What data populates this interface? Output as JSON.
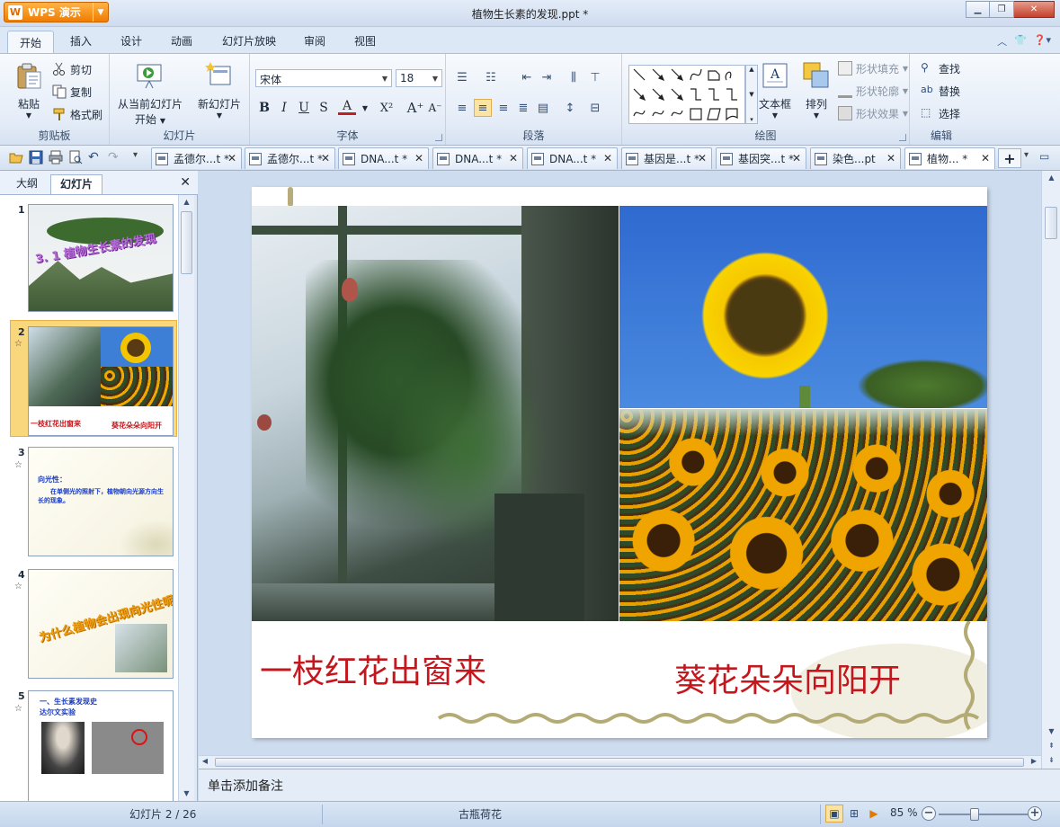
{
  "app": {
    "name": "WPS 演示",
    "logo_letter": "W",
    "document_title": "植物生长素的发现.ppt *"
  },
  "ribbon_tabs": [
    "开始",
    "插入",
    "设计",
    "动画",
    "幻灯片放映",
    "审阅",
    "视图"
  ],
  "ribbon": {
    "clipboard": {
      "paste": "粘贴",
      "cut": "剪切",
      "copy": "复制",
      "format_painter": "格式刷",
      "label": "剪贴板"
    },
    "slides": {
      "play_from_current": "从当前幻灯片",
      "play_from_current_2": "开始",
      "new_slide": "新幻灯片",
      "label": "幻灯片"
    },
    "font": {
      "family": "宋体",
      "size": "18",
      "label": "字体"
    },
    "paragraph": {
      "label": "段落"
    },
    "drawing": {
      "textbox": "文本框",
      "arrange": "排列",
      "shape_fill": "形状填充",
      "shape_outline": "形状轮廓",
      "shape_effects": "形状效果",
      "label": "绘图"
    },
    "editing": {
      "find": "查找",
      "replace": "替换",
      "select": "选择",
      "label": "编辑"
    }
  },
  "doc_tabs": [
    {
      "label": "孟德尔...t *",
      "active": false
    },
    {
      "label": "孟德尔...t *",
      "active": false
    },
    {
      "label": "DNA...t *",
      "active": false
    },
    {
      "label": "DNA...t *",
      "active": false
    },
    {
      "label": "DNA...t *",
      "active": false
    },
    {
      "label": "基因是...t *",
      "active": false
    },
    {
      "label": "基因突...t *",
      "active": false
    },
    {
      "label": "染色...pt",
      "active": false
    },
    {
      "label": "植物... *",
      "active": true
    }
  ],
  "panel": {
    "tab_outline": "大纲",
    "tab_slides": "幻灯片",
    "thumbnails": [
      {
        "num": "1",
        "title": "3. 1 植物生长素的发现"
      },
      {
        "num": "2",
        "cap_left": "一枝红花出窗来",
        "cap_right": "葵花朵朵向阳开"
      },
      {
        "num": "3",
        "heading": "向光性：",
        "body": "在单侧光的照射下，植物朝向光源方向生长的现象。"
      },
      {
        "num": "4",
        "title": "为什么植物会出现向光性呢？"
      },
      {
        "num": "5",
        "line1": "一、生长素发现史",
        "line2": "达尔文实验"
      }
    ]
  },
  "slide": {
    "caption_left": "一枝红花出窗来",
    "caption_right": "葵花朵朵向阳开"
  },
  "notes_placeholder": "单击添加备注",
  "status": {
    "slide_indicator": "幻灯片 2 / 26",
    "theme": "古瓶荷花",
    "zoom": "85 %"
  },
  "colors": {
    "caption_red": "#c4171d",
    "accent_orange": "#f07c00",
    "thumb_selected": "#f9d77d"
  }
}
